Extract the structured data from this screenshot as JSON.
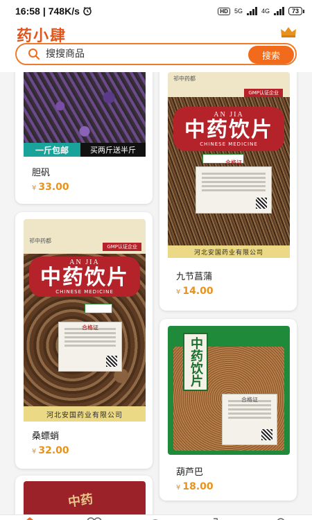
{
  "status_bar": {
    "time": "16:58",
    "speed": "748K/s",
    "hd": "HD",
    "net1": "5G",
    "net2": "4G",
    "battery": "73"
  },
  "header": {
    "logo": "药小肆"
  },
  "search": {
    "placeholder": "搜搜商品",
    "button": "搜索"
  },
  "products": [
    {
      "name": "胆矾",
      "currency": "¥",
      "price": "33.00",
      "promo_left": "一斤包邮",
      "promo_right": "买两斤送半斤"
    },
    {
      "name": "九节菖蒲",
      "currency": "¥",
      "price": "14.00",
      "bag_brand": "祁中药都",
      "bag_cert": "GMP认证企业",
      "bag_en": "AN JIA",
      "bag_cn": "中药饮片",
      "bag_sub": "CHINESE MEDICINE",
      "bag_label": "合格证",
      "bag_company": "河北安国药业有限公司"
    },
    {
      "name": "桑螵蛸",
      "currency": "¥",
      "price": "32.00",
      "bag_brand": "祁中药都",
      "bag_cert": "GMP认证企业",
      "bag_en": "AN JIA",
      "bag_cn": "中药饮片",
      "bag_sub": "CHINESE MEDICINE",
      "bag_label": "合格证",
      "bag_company": "河北安国药业有限公司"
    },
    {
      "name": "葫芦巴",
      "currency": "¥",
      "price": "18.00",
      "bag_cn": "中药饮片",
      "bag_label": "合格证"
    },
    {
      "bag_cn": "中药"
    }
  ],
  "colors": {
    "accent": "#f26a1b",
    "logo": "#e2541a",
    "price": "#e8921e",
    "bag_red": "#b4232a",
    "bag_green": "#2e8b3a"
  },
  "icons": {
    "search": "search-icon",
    "crown": "crown-icon",
    "home": "home-icon",
    "category": "category-icon",
    "chat": "chat-icon",
    "cart": "cart-icon",
    "profile": "profile-icon"
  }
}
